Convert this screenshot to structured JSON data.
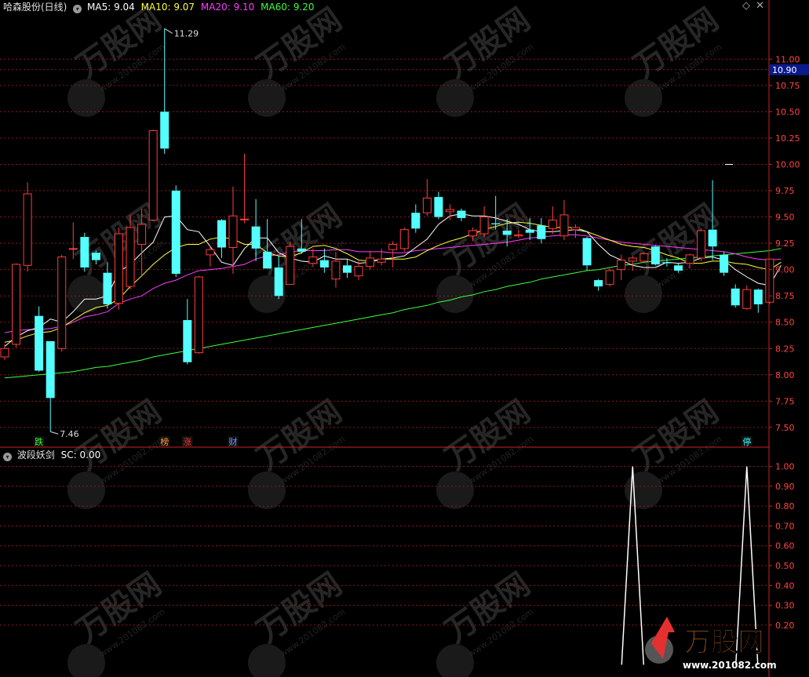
{
  "header": {
    "stock_title": "哈森股份(日线)",
    "ma5": "MA5: 9.04",
    "ma10": "MA10: 9.07",
    "ma20": "MA20: 9.10",
    "ma60": "MA60: 9.20",
    "indicator_title": "波段妖剑",
    "indicator_value": "SC: 0.00"
  },
  "colors": {
    "up": "#ff3c3c",
    "down": "#54ffff",
    "ma5": "#ffffff",
    "ma10": "#ffff3c",
    "ma20": "#ff3cff",
    "ma60": "#3cff3c",
    "axis": "#cc2222",
    "grid": "#8b1a1a",
    "price_label": "#ff4444",
    "highlight_bg": "#0a1a8c",
    "sc_line": "#ffffff"
  },
  "markers": [
    {
      "text": "跌",
      "color": "#33ff33",
      "index": 3
    },
    {
      "text": "榜",
      "color": "#ff9933",
      "index": 14
    },
    {
      "text": "涨",
      "color": "#ff3333",
      "index": 16
    },
    {
      "text": "财",
      "color": "#6699ff",
      "index": 20
    },
    {
      "text": "停",
      "color": "#33ffff",
      "index": 65
    }
  ],
  "watermark": {
    "logo": "万股网",
    "url": "www.201082.com"
  },
  "chart_data": [
    {
      "type": "candlestick",
      "title": "哈森股份(日线)",
      "y_ticks": [
        "7.50",
        "7.75",
        "8.00",
        "8.25",
        "8.50",
        "8.75",
        "9.00",
        "9.25",
        "9.50",
        "9.75",
        "10.00",
        "10.25",
        "10.50",
        "10.75",
        "10.90",
        "11.00"
      ],
      "ylim": [
        7.35,
        11.45
      ],
      "current_price": "10.90",
      "high_label": "11.29",
      "low_label": "7.46",
      "ohlc": [
        [
          8.17,
          8.29,
          8.14,
          8.25
        ],
        [
          8.29,
          9.06,
          8.26,
          9.05
        ],
        [
          9.04,
          9.83,
          8.98,
          9.72
        ],
        [
          8.56,
          8.65,
          8.03,
          8.04
        ],
        [
          8.32,
          8.32,
          7.46,
          7.78
        ],
        [
          8.25,
          9.14,
          8.22,
          9.12
        ],
        [
          9.2,
          9.45,
          9.1,
          9.2
        ],
        [
          9.31,
          9.35,
          8.98,
          9.02
        ],
        [
          9.16,
          9.18,
          9.05,
          9.09
        ],
        [
          8.97,
          9.07,
          8.63,
          8.67
        ],
        [
          8.68,
          9.4,
          8.62,
          9.34
        ],
        [
          8.84,
          9.52,
          8.81,
          9.4
        ],
        [
          9.24,
          9.58,
          8.93,
          9.43
        ],
        [
          9.47,
          10.33,
          9.46,
          10.32
        ],
        [
          10.5,
          11.29,
          10.1,
          10.15
        ],
        [
          9.75,
          9.8,
          8.93,
          8.96
        ],
        [
          8.52,
          8.72,
          8.1,
          8.12
        ],
        [
          8.21,
          8.94,
          8.2,
          8.93
        ],
        [
          9.14,
          9.22,
          9.03,
          9.19
        ],
        [
          9.47,
          9.48,
          9.11,
          9.21
        ],
        [
          9.21,
          9.79,
          8.96,
          9.51
        ],
        [
          9.48,
          10.1,
          9.44,
          9.48
        ],
        [
          9.41,
          9.67,
          9.08,
          9.2
        ],
        [
          9.17,
          9.48,
          9.01,
          9.01
        ],
        [
          9.02,
          9.13,
          8.72,
          8.75
        ],
        [
          8.86,
          9.27,
          8.86,
          9.22
        ],
        [
          9.2,
          9.48,
          9.15,
          9.17
        ],
        [
          9.06,
          9.2,
          9.03,
          9.12
        ],
        [
          9.09,
          9.2,
          8.97,
          9.02
        ],
        [
          8.91,
          9.17,
          8.83,
          9.08
        ],
        [
          9.04,
          9.1,
          8.92,
          8.97
        ],
        [
          8.94,
          9.08,
          8.9,
          9.03
        ],
        [
          9.03,
          9.18,
          9.0,
          9.11
        ],
        [
          9.07,
          9.2,
          9.04,
          9.1
        ],
        [
          9.19,
          9.27,
          9.02,
          9.24
        ],
        [
          9.2,
          9.4,
          9.17,
          9.38
        ],
        [
          9.54,
          9.62,
          9.35,
          9.39
        ],
        [
          9.54,
          9.86,
          9.51,
          9.68
        ],
        [
          9.69,
          9.74,
          9.48,
          9.5
        ],
        [
          9.55,
          9.62,
          9.47,
          9.57
        ],
        [
          9.56,
          9.58,
          9.46,
          9.49
        ],
        [
          9.32,
          9.4,
          9.27,
          9.37
        ],
        [
          9.34,
          9.6,
          9.31,
          9.5
        ],
        [
          9.44,
          9.7,
          9.38,
          9.43
        ],
        [
          9.37,
          9.48,
          9.22,
          9.33
        ],
        [
          9.32,
          9.38,
          9.3,
          9.33
        ],
        [
          9.38,
          9.49,
          9.28,
          9.35
        ],
        [
          9.42,
          9.49,
          9.25,
          9.29
        ],
        [
          9.39,
          9.6,
          9.34,
          9.47
        ],
        [
          9.32,
          9.66,
          9.28,
          9.52
        ],
        [
          9.38,
          9.43,
          9.3,
          9.4
        ],
        [
          9.3,
          9.31,
          8.99,
          9.04
        ],
        [
          8.9,
          8.91,
          8.8,
          8.84
        ],
        [
          8.86,
          9.01,
          8.84,
          8.99
        ],
        [
          9.0,
          9.14,
          8.9,
          9.09
        ],
        [
          9.08,
          9.13,
          8.99,
          9.11
        ],
        [
          9.08,
          9.17,
          9.06,
          9.15
        ],
        [
          9.22,
          9.23,
          9.04,
          9.05
        ],
        [
          9.07,
          9.11,
          9.03,
          9.06
        ],
        [
          9.04,
          9.06,
          8.97,
          8.99
        ],
        [
          9.06,
          9.15,
          9.01,
          9.14
        ],
        [
          9.11,
          9.39,
          9.08,
          9.37
        ],
        [
          9.38,
          9.85,
          9.09,
          9.22
        ],
        [
          9.14,
          9.17,
          8.94,
          8.97
        ],
        [
          8.82,
          8.86,
          8.64,
          8.66
        ],
        [
          8.63,
          8.85,
          8.62,
          8.81
        ],
        [
          8.81,
          8.82,
          8.59,
          8.67
        ],
        [
          8.69,
          8.91,
          8.67,
          9.1
        ]
      ],
      "ma5": [
        8.27,
        8.36,
        8.42,
        8.45,
        8.53,
        8.5,
        8.6,
        8.72,
        8.72,
        8.75,
        8.98,
        9.05,
        9.16,
        9.26,
        9.5,
        9.51,
        9.38,
        9.36,
        9.22,
        9.07,
        9.04,
        9.2,
        9.3,
        9.3,
        9.16,
        9.11,
        9.08,
        9.07,
        9.13,
        9.1,
        9.1,
        9.06,
        9.07,
        9.1,
        9.11,
        9.13,
        9.21,
        9.29,
        9.43,
        9.51,
        9.53,
        9.51,
        9.51,
        9.49,
        9.46,
        9.43,
        9.38,
        9.36,
        9.36,
        9.37,
        9.38,
        9.36,
        9.24,
        9.14,
        9.09,
        9.04,
        9.02,
        9.02,
        9.07,
        9.06,
        9.07,
        9.11,
        9.12,
        9.09,
        9.0,
        8.93,
        8.87,
        8.85,
        9.04
      ],
      "ma10": [
        8.31,
        8.33,
        8.37,
        8.4,
        8.41,
        8.45,
        8.52,
        8.59,
        8.64,
        8.66,
        8.72,
        8.84,
        8.94,
        9.05,
        9.14,
        9.21,
        9.24,
        9.24,
        9.29,
        9.31,
        9.29,
        9.24,
        9.24,
        9.16,
        9.13,
        9.12,
        9.16,
        9.22,
        9.23,
        9.2,
        9.15,
        9.09,
        9.08,
        9.1,
        9.1,
        9.1,
        9.12,
        9.18,
        9.23,
        9.27,
        9.3,
        9.34,
        9.38,
        9.41,
        9.44,
        9.45,
        9.44,
        9.42,
        9.4,
        9.4,
        9.4,
        9.36,
        9.32,
        9.28,
        9.24,
        9.22,
        9.21,
        9.18,
        9.14,
        9.11,
        9.06,
        9.06,
        9.08,
        9.08,
        9.06,
        9.05,
        9.02,
        9.0,
        9.07
      ],
      "ma20": [
        8.4,
        8.42,
        8.43,
        8.43,
        8.44,
        8.46,
        8.5,
        8.55,
        8.57,
        8.6,
        8.68,
        8.72,
        8.75,
        8.82,
        8.87,
        8.9,
        8.95,
        8.99,
        9.0,
        9.01,
        9.03,
        9.05,
        9.1,
        9.13,
        9.14,
        9.17,
        9.18,
        9.18,
        9.18,
        9.19,
        9.19,
        9.17,
        9.17,
        9.17,
        9.16,
        9.16,
        9.18,
        9.19,
        9.2,
        9.21,
        9.22,
        9.23,
        9.24,
        9.25,
        9.26,
        9.28,
        9.3,
        9.31,
        9.32,
        9.33,
        9.33,
        9.32,
        9.3,
        9.28,
        9.26,
        9.25,
        9.24,
        9.23,
        9.22,
        9.21,
        9.2,
        9.19,
        9.18,
        9.17,
        9.15,
        9.12,
        9.1,
        9.09,
        9.1
      ],
      "ma60": [
        7.97,
        7.98,
        7.99,
        8.0,
        8.01,
        8.02,
        8.03,
        8.05,
        8.07,
        8.08,
        8.1,
        8.12,
        8.14,
        8.17,
        8.19,
        8.21,
        8.23,
        8.25,
        8.27,
        8.29,
        8.31,
        8.33,
        8.35,
        8.37,
        8.39,
        8.41,
        8.43,
        8.45,
        8.47,
        8.49,
        8.51,
        8.53,
        8.55,
        8.57,
        8.59,
        8.62,
        8.64,
        8.66,
        8.69,
        8.71,
        8.74,
        8.76,
        8.79,
        8.81,
        8.84,
        8.86,
        8.88,
        8.91,
        8.93,
        8.95,
        8.97,
        8.99,
        9.0,
        9.02,
        9.04,
        9.05,
        9.07,
        9.08,
        9.09,
        9.1,
        9.11,
        9.12,
        9.13,
        9.14,
        9.15,
        9.16,
        9.17,
        9.18,
        9.2
      ]
    },
    {
      "type": "line",
      "title": "波段妖剑",
      "series": [
        {
          "name": "SC",
          "values": [
            0,
            0,
            0,
            0,
            0,
            0,
            0,
            0,
            0,
            0,
            0,
            0,
            0,
            0,
            0,
            0,
            0,
            0,
            0,
            0,
            0,
            0,
            0,
            0,
            0,
            0,
            0,
            0,
            0,
            0,
            0,
            0,
            0,
            0,
            0,
            0,
            0,
            0,
            0,
            0,
            0,
            0,
            0,
            0,
            0,
            0,
            0,
            0,
            0,
            0,
            0,
            0,
            0,
            0,
            0,
            1,
            0,
            0,
            0,
            0,
            0,
            0,
            0,
            0,
            0,
            1,
            0,
            0,
            0
          ]
        }
      ],
      "y_ticks": [
        "0.20",
        "0.30",
        "0.40",
        "0.50",
        "0.60",
        "0.70",
        "0.80",
        "0.90",
        "1.00"
      ],
      "ylim": [
        -0.05,
        1.05
      ]
    }
  ]
}
